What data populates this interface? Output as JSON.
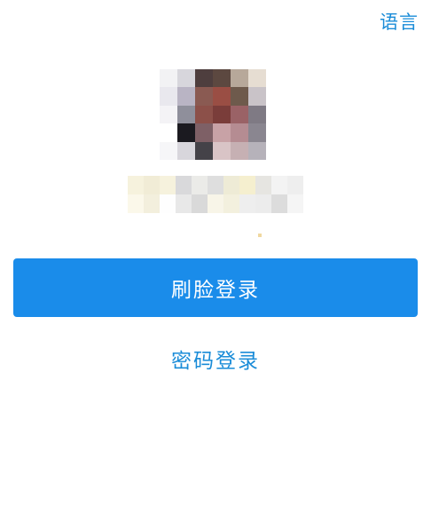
{
  "header": {
    "language_link": "语言"
  },
  "user": {
    "avatar": "avatar-image",
    "display_name": ""
  },
  "actions": {
    "face_login_label": "刷脸登录",
    "password_login_label": "密码登录"
  },
  "colors": {
    "accent": "#1a8cea",
    "link": "#1a8cd8",
    "background": "#ffffff"
  }
}
